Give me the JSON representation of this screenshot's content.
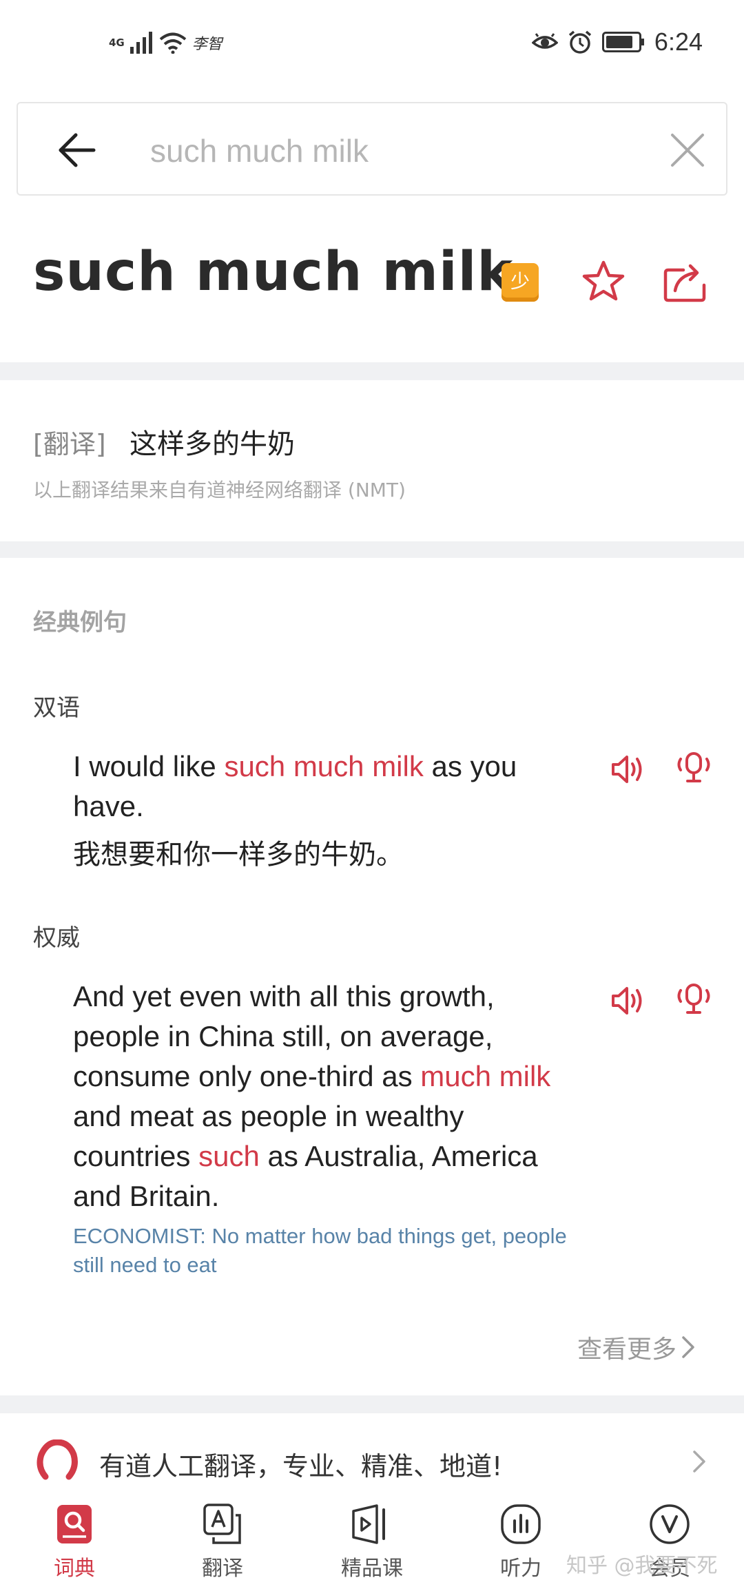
{
  "status_bar": {
    "network": "4G",
    "carrier_mark": "李智",
    "time": "6:24"
  },
  "search": {
    "query": "such much milk"
  },
  "headword": {
    "text": "such much milk",
    "badge": "少"
  },
  "translation": {
    "tag": "[翻译]",
    "text": "这样多的牛奶",
    "note": "以上翻译结果来自有道神经网络翻译 (NMT)"
  },
  "examples": {
    "section_title": "经典例句",
    "bilingual": {
      "label": "双语",
      "en_part1": "I would like ",
      "en_highlight": "such much milk",
      "en_part2": " as you have.",
      "cn": "我想要和你一样多的牛奶。"
    },
    "authority": {
      "label": "权威",
      "p1": "And yet even with all this growth, people in China still, on average, consume only one-third as ",
      "h1": "much milk",
      "p2": " and meat as people in wealthy countries ",
      "h2": "such",
      "p3": " as Australia, America and Britain.",
      "source": "ECONOMIST: No matter how bad things get, people still need to eat"
    },
    "more_label": "查看更多"
  },
  "promo": {
    "text": "有道人工翻译，专业、精准、地道!"
  },
  "nav": {
    "items": [
      {
        "label": "词典",
        "icon": "dictionary-icon",
        "active": true
      },
      {
        "label": "翻译",
        "icon": "translate-icon",
        "active": false
      },
      {
        "label": "精品课",
        "icon": "course-icon",
        "active": false
      },
      {
        "label": "听力",
        "icon": "listening-icon",
        "active": false
      },
      {
        "label": "会员",
        "icon": "vip-icon",
        "active": false
      }
    ]
  },
  "watermark": "知乎 @我要不死",
  "colors": {
    "accent": "#d23a48",
    "source_blue": "#5883a8",
    "badge": "#f6a623",
    "divider": "#f0f1f3"
  }
}
